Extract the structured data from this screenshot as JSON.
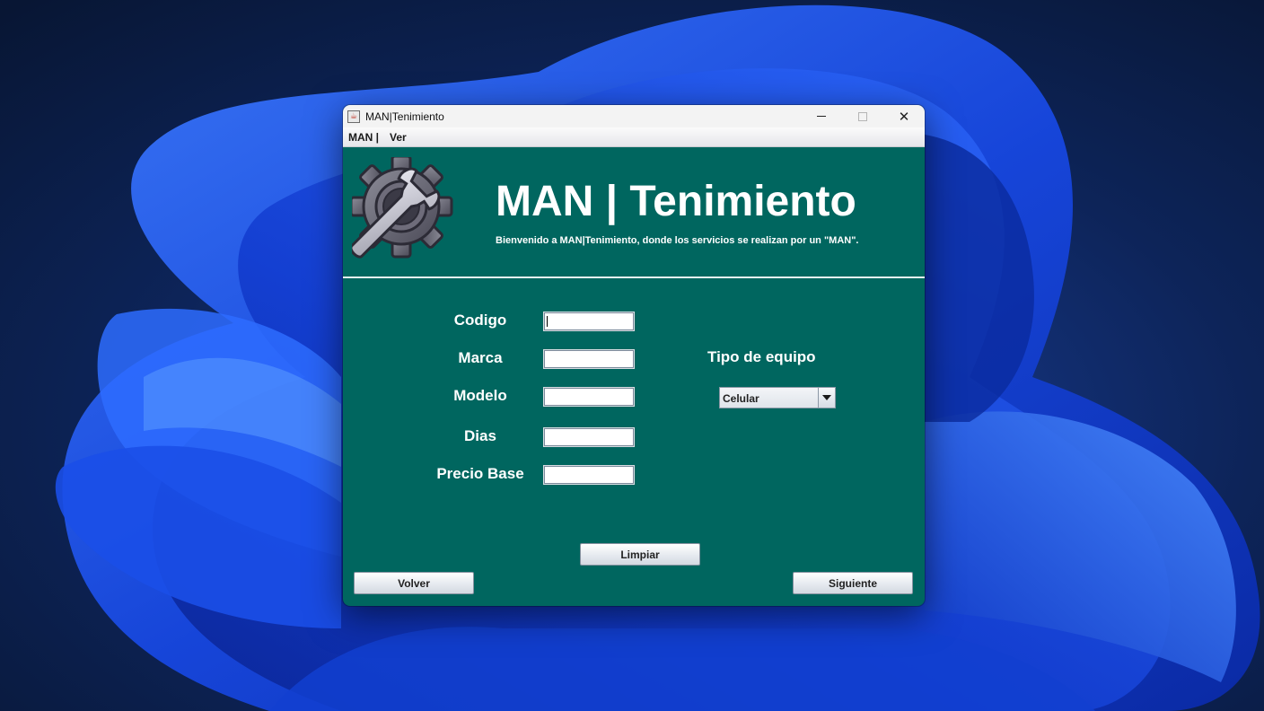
{
  "window": {
    "title": "MAN|Tenimiento",
    "app_icon": "java-cup-icon",
    "controls": {
      "minimize": "minimize-icon",
      "maximize": "maximize-icon",
      "close": "✕"
    }
  },
  "menubar": {
    "items": [
      {
        "label": "MAN |"
      },
      {
        "label": "Ver"
      }
    ]
  },
  "header": {
    "logo": "gear-wrench-icon",
    "title": "MAN | Tenimiento",
    "subtitle": "Bienvenido a MAN|Tenimiento, donde los servicios se realizan por un \"MAN\"."
  },
  "form": {
    "fields": [
      {
        "label": "Codigo",
        "value": ""
      },
      {
        "label": "Marca",
        "value": ""
      },
      {
        "label": "Modelo",
        "value": ""
      },
      {
        "label": "Dias",
        "value": ""
      },
      {
        "label": "Precio Base",
        "value": ""
      }
    ],
    "tipo_equipo": {
      "label": "Tipo de equipo",
      "selected": "Celular"
    }
  },
  "buttons": {
    "limpiar": "Limpiar",
    "volver": "Volver",
    "siguiente": "Siguiente"
  },
  "colors": {
    "panel": "#00665f",
    "text": "#ffffff",
    "desktop": "#0b1d44",
    "bloom": "#1e4fe0"
  }
}
